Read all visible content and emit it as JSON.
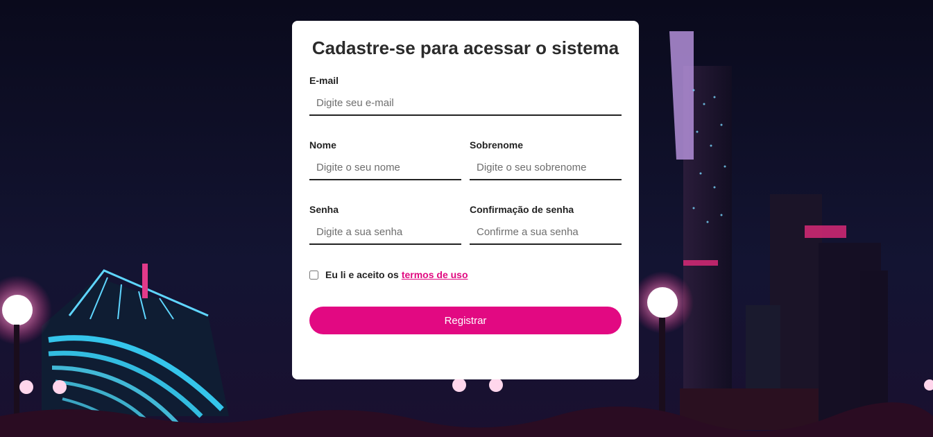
{
  "form": {
    "title": "Cadastre-se para acessar o sistema",
    "email": {
      "label": "E-mail",
      "placeholder": "Digite seu e-mail",
      "value": ""
    },
    "first_name": {
      "label": "Nome",
      "placeholder": "Digite o seu nome",
      "value": ""
    },
    "last_name": {
      "label": "Sobrenome",
      "placeholder": "Digite o seu sobrenome",
      "value": ""
    },
    "password": {
      "label": "Senha",
      "placeholder": "Digite a sua senha",
      "value": ""
    },
    "password_confirm": {
      "label": "Confirmação de senha",
      "placeholder": "Confirme a sua senha",
      "value": ""
    },
    "terms": {
      "prefix": "Eu li e aceito os",
      "link": "termos de uso",
      "checked": false
    },
    "submit_label": "Registrar"
  },
  "colors": {
    "accent": "#e20982",
    "link": "#e0087f",
    "card_bg": "#ffffff",
    "background": "#0b0a1a"
  }
}
